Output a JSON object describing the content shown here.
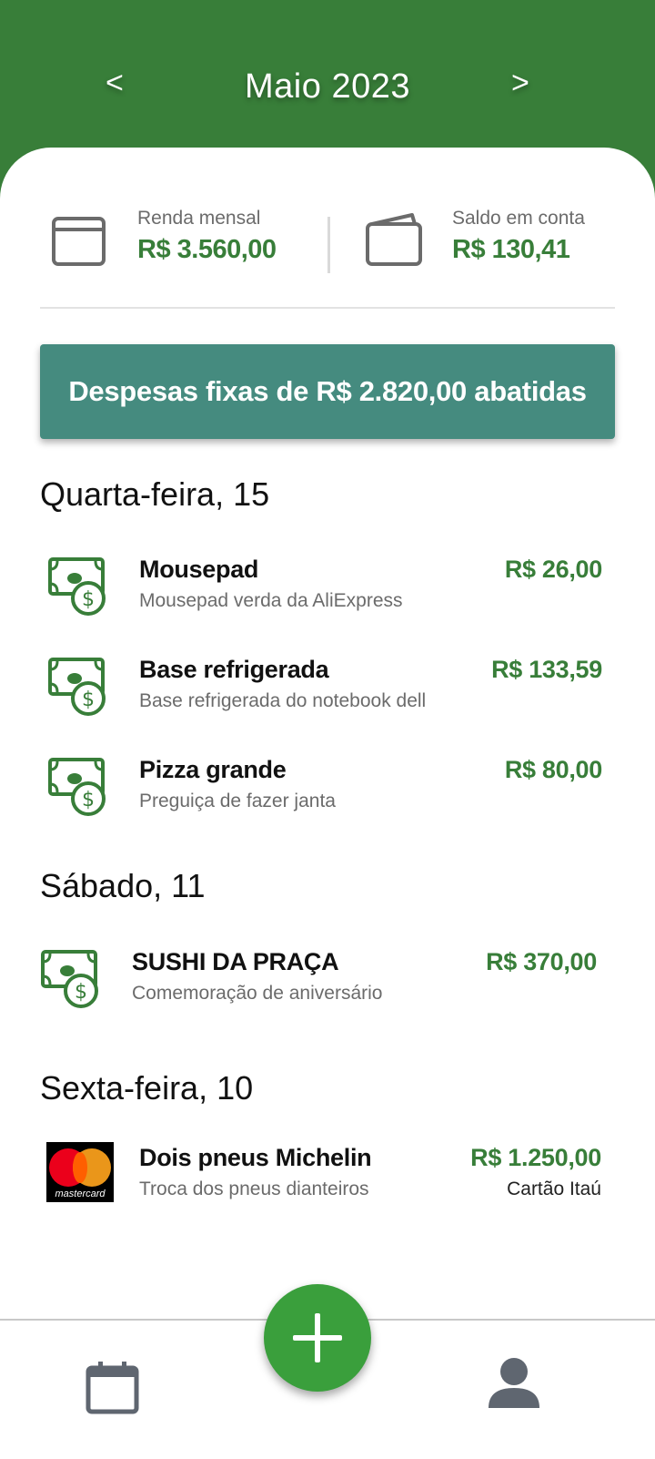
{
  "header": {
    "prev_label": "<",
    "month_title": "Maio 2023",
    "next_label": ">",
    "background": "#387e39"
  },
  "summary": {
    "income": {
      "icon": "card-icon",
      "label": "Renda mensal",
      "value": "R$ 3.560,00"
    },
    "balance": {
      "icon": "wallet-icon",
      "label": "Saldo em conta",
      "value": "R$ 130,41"
    }
  },
  "fixed_expenses_banner": {
    "text": "Despesas fixas de R$ 2.820,00 abatidas",
    "color": "#458b7f"
  },
  "days": [
    {
      "heading": "Quarta-feira, 15",
      "transactions": [
        {
          "icon": "cash-icon",
          "title": "Mousepad",
          "description": "Mousepad verda da AliExpress",
          "amount": "R$ 26,00"
        },
        {
          "icon": "cash-icon",
          "title": "Base refrigerada",
          "description": "Base refrigerada do notebook dell",
          "amount": "R$ 133,59"
        },
        {
          "icon": "cash-icon",
          "title": "Pizza grande",
          "description": "Preguiça de fazer janta",
          "amount": "R$ 80,00"
        }
      ]
    },
    {
      "heading": "Sábado, 11",
      "transactions": [
        {
          "icon": "cash-icon",
          "title": "SUSHI DA PRAÇA",
          "description": "Comemoração de aniversário",
          "amount": "R$ 370,00"
        }
      ]
    },
    {
      "heading": "Sexta-feira, 10",
      "transactions": [
        {
          "icon": "mastercard-icon",
          "logo_text": "mastercard",
          "title": "Dois pneus Michelin",
          "description": "Troca dos pneus dianteiros",
          "amount": "R$ 1.250,00",
          "payment_method": "Cartão Itaú"
        }
      ]
    }
  ],
  "bottom_nav": {
    "calendar_icon": "calendar-icon",
    "add_icon": "plus-icon",
    "profile_icon": "person-icon",
    "fab_color": "#3a9f3c"
  }
}
